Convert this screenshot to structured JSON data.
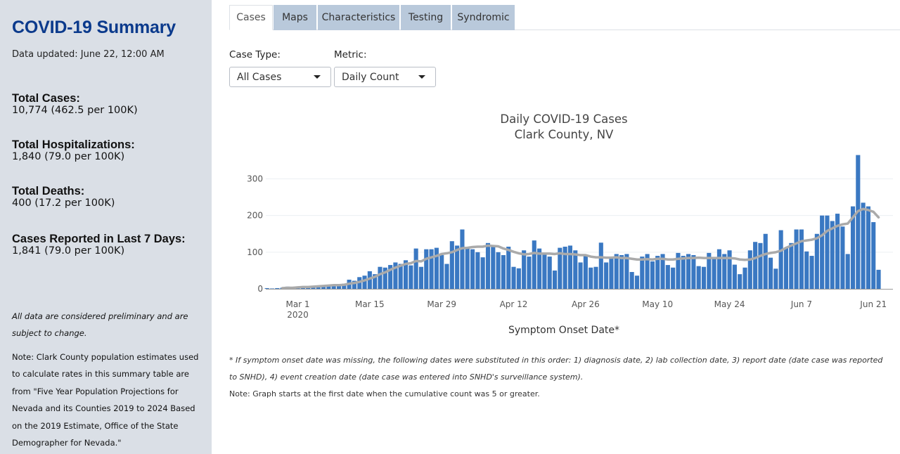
{
  "sidebar": {
    "title": "COVID-19 Summary",
    "updated": "Data updated: June 22, 12:00 AM",
    "stats": [
      {
        "label": "Total Cases:",
        "value": "10,774 (462.5 per 100K)"
      },
      {
        "label": "Total Hospitalizations:",
        "value": "1,840 (79.0 per 100K)"
      },
      {
        "label": "Total Deaths:",
        "value": "400 (17.2 per 100K)"
      },
      {
        "label": "Cases Reported in Last 7 Days:",
        "value": "1,841 (79.0 per 100K)"
      }
    ],
    "preliminary_note": "All data are considered preliminary and are subject to change.",
    "population_note": "Note: Clark County population estimates used to calculate rates in this summary table are from \"Five Year Population Projections for Nevada and its Counties 2019 to 2024 Based on the 2019 Estimate, Office of the State Demographer for Nevada.\""
  },
  "tabs": [
    "Cases",
    "Maps",
    "Characteristics",
    "Testing",
    "Syndromic"
  ],
  "active_tab": "Cases",
  "controls": {
    "case_type_label": "Case Type:",
    "case_type_value": "All Cases",
    "metric_label": "Metric:",
    "metric_value": "Daily Count"
  },
  "footnotes": {
    "symptom": "* If symptom onset date was missing, the following dates were substituted in this order: 1) diagnosis date, 2) lab collection date, 3) report date (date case was reported to SNHD), 4) event creation date (date case was entered into SNHD's surveillance system).",
    "graph": "Note: Graph starts at the first date when the cumulative count was 5 or greater."
  },
  "colors": {
    "bar": "#3a78c2",
    "average_line": "#aaaaaa",
    "sidebar_bg": "#dadfe6",
    "title": "#0b3a8c",
    "tab_bg": "#b9c9db"
  },
  "chart_data": {
    "type": "bar",
    "title": "Daily COVID-19 Cases",
    "subtitle": "Clark County, NV",
    "xlabel": "Symptom Onset Date*",
    "ylabel": "",
    "ylim": [
      0,
      370
    ],
    "yticks": [
      0,
      100,
      200,
      300
    ],
    "x_start": "2020-02-24",
    "x_tick_labels": [
      "Mar 1\n2020",
      "Mar 15",
      "Mar 29",
      "Apr 12",
      "Apr 26",
      "May 10",
      "May 24",
      "Jun 7",
      "Jun 21"
    ],
    "series": [
      {
        "type": "bar",
        "values": [
          2,
          1,
          2,
          3,
          6,
          4,
          5,
          7,
          7,
          8,
          9,
          10,
          10,
          11,
          12,
          14,
          25,
          22,
          32,
          36,
          48,
          40,
          60,
          58,
          65,
          72,
          68,
          78,
          64,
          110,
          60,
          108,
          108,
          112,
          92,
          68,
          130,
          118,
          162,
          110,
          108,
          100,
          86,
          125,
          115,
          100,
          92,
          115,
          60,
          56,
          105,
          88,
          132,
          110,
          95,
          88,
          50,
          112,
          115,
          118,
          105,
          72,
          92,
          58,
          60,
          126,
          72,
          88,
          95,
          92,
          95,
          46,
          36,
          88,
          95,
          75,
          90,
          95,
          65,
          58,
          98,
          90,
          95,
          92,
          62,
          60,
          98,
          85,
          108,
          95,
          105,
          66,
          40,
          58,
          105,
          128,
          125,
          150,
          85,
          55,
          160,
          112,
          125,
          162,
          162,
          102,
          90,
          150,
          200,
          200,
          185,
          205,
          170,
          95,
          225,
          365,
          235,
          225,
          182,
          52
        ]
      },
      {
        "type": "line",
        "name": "",
        "values": [
          null,
          null,
          null,
          2,
          3,
          3,
          4,
          5,
          5,
          6,
          7,
          8,
          9,
          10,
          10,
          11,
          14,
          16,
          19,
          23,
          28,
          33,
          40,
          45,
          52,
          58,
          63,
          68,
          70,
          76,
          75,
          82,
          86,
          90,
          95,
          97,
          100,
          106,
          111,
          112,
          114,
          115,
          115,
          118,
          117,
          116,
          110,
          106,
          101,
          97,
          94,
          95,
          98,
          96,
          96,
          96,
          95,
          97,
          95,
          95,
          94,
          92,
          92,
          88,
          86,
          86,
          85,
          85,
          86,
          84,
          84,
          82,
          80,
          80,
          81,
          80,
          82,
          82,
          80,
          80,
          82,
          83,
          84,
          84,
          85,
          84,
          84,
          84,
          84,
          84,
          84,
          83,
          80,
          79,
          80,
          84,
          90,
          95,
          98,
          100,
          104,
          112,
          118,
          124,
          130,
          132,
          134,
          138,
          146,
          158,
          165,
          172,
          176,
          178,
          195,
          212,
          218,
          215,
          210,
          195
        ]
      }
    ],
    "grid": true,
    "legend": "none"
  }
}
